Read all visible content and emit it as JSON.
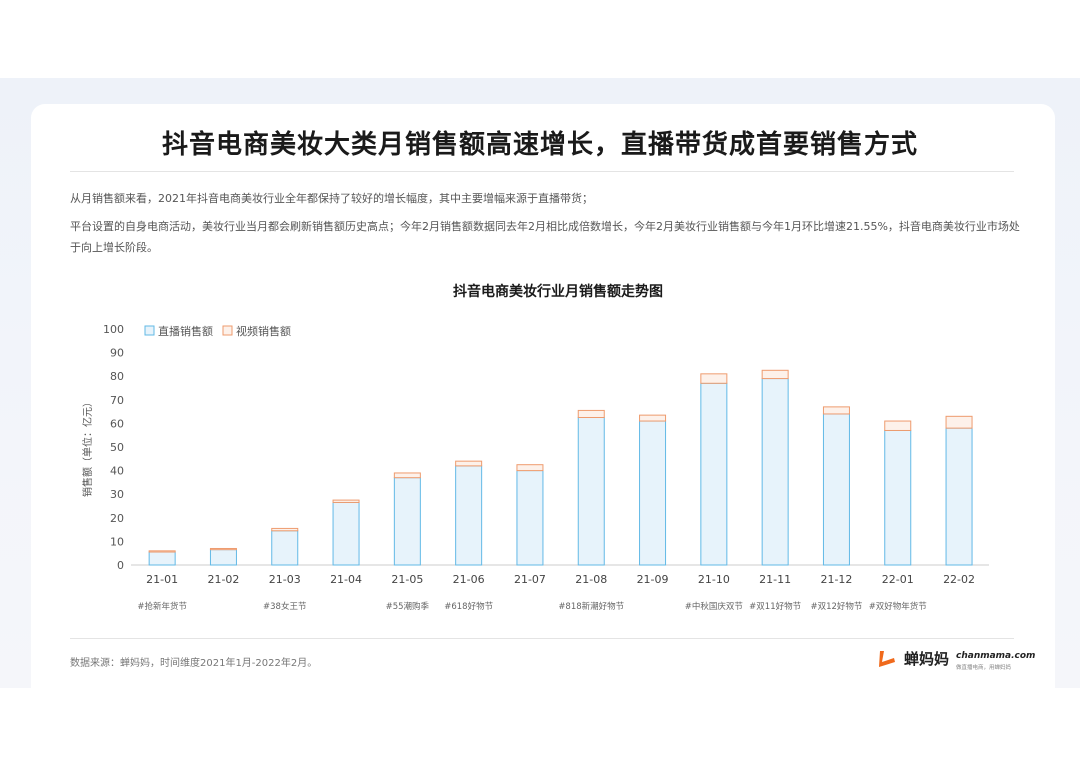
{
  "title": "抖音电商美妆大类月销售额高速增长，直播带货成首要销售方式",
  "paragraphs": [
    "从月销售额来看，2021年抖音电商美妆行业全年都保持了较好的增长幅度，其中主要增幅来源于直播带货；",
    "平台设置的自身电商活动，美妆行业当月都会刷新销售额历史高点；今年2月销售额数据同去年2月相比成倍数增长，今年2月美妆行业销售额与今年1月环比增速21.55%，抖音电商美妆行业市场处于向上增长阶段。"
  ],
  "source": "数据来源：蝉妈妈，时间维度2021年1月-2022年2月。",
  "logo": {
    "name": "蝉妈妈",
    "domain": "chanmama.com",
    "tagline": "做直播电商，用蝉妈妈"
  },
  "colors": {
    "live_fill": "#e7f3fb",
    "live_stroke": "#62b9e6",
    "video_fill": "#fdf1ea",
    "video_stroke": "#ee9b6e",
    "logo_orange": "#f06a1c"
  },
  "chart_data": {
    "type": "bar",
    "stacked": true,
    "title": "抖音电商美妆行业月销售额走势图",
    "ylabel": "销售额（单位：亿元）",
    "xlabel": "",
    "ylim": [
      0,
      100
    ],
    "yticks": [
      0,
      10,
      20,
      30,
      40,
      50,
      60,
      70,
      80,
      90,
      100
    ],
    "grid": false,
    "legend_position": "top-left",
    "categories": [
      "21-01",
      "21-02",
      "21-03",
      "21-04",
      "21-05",
      "21-06",
      "21-07",
      "21-08",
      "21-09",
      "21-10",
      "21-11",
      "21-12",
      "22-01",
      "22-02"
    ],
    "series": [
      {
        "name": "直播销售额",
        "values": [
          5.5,
          6.5,
          14.5,
          26.5,
          37,
          42,
          40,
          62.5,
          61,
          77,
          79,
          64,
          57,
          58
        ]
      },
      {
        "name": "视频销售额",
        "values": [
          0.5,
          0.5,
          1,
          1,
          2,
          2,
          2.5,
          3,
          2.5,
          4,
          3.5,
          3,
          4,
          5
        ]
      }
    ],
    "annotations": [
      {
        "category": "21-01",
        "text": "#抢新年货节"
      },
      {
        "category": "21-03",
        "text": "#38女王节"
      },
      {
        "category": "21-05",
        "text": "#55潮购季"
      },
      {
        "category": "21-06",
        "text": "#618好物节"
      },
      {
        "category": "21-08",
        "text": "#818新潮好物节"
      },
      {
        "category": "21-10",
        "text": "#中秋国庆双节"
      },
      {
        "category": "21-11",
        "text": "#双11好物节"
      },
      {
        "category": "21-12",
        "text": "#双12好物节"
      },
      {
        "category": "22-01",
        "text": "#双好物年货节"
      }
    ]
  }
}
